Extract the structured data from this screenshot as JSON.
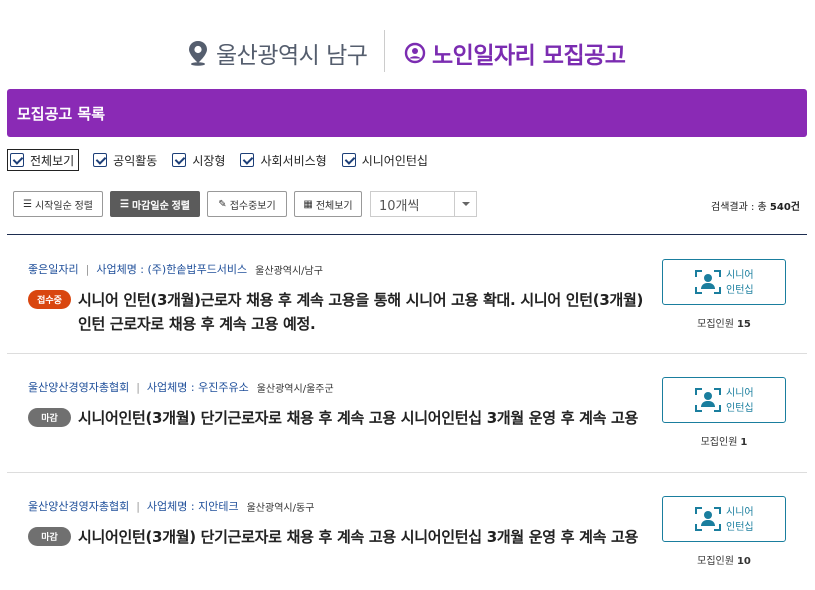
{
  "header": {
    "location": "울산광역시 남구",
    "title": "노인일자리 모집공고",
    "location_icon": "map-pin-icon",
    "title_icon": "person-circle-icon",
    "title_color": "#7b2cb1"
  },
  "section": {
    "title": "모집공고 목록",
    "color": "#8a2ab5"
  },
  "filters": [
    {
      "label": "전체보기",
      "checked": true
    },
    {
      "label": "공익활동",
      "checked": true
    },
    {
      "label": "시장형",
      "checked": true
    },
    {
      "label": "사회서비스형",
      "checked": true
    },
    {
      "label": "시니어인턴십",
      "checked": true
    }
  ],
  "toolbar": {
    "sort_start": "시작일순 정렬",
    "sort_deadline": "마감일순 정렬",
    "receiving": "접수중보기",
    "view_all": "전체보기",
    "per_page": "10개씩",
    "result_label": "검색결과 : 총",
    "result_count": "540건"
  },
  "items": [
    {
      "org": "좋은일자리",
      "biz": "사업체명 : (주)한솥밥푸드서비스",
      "region": "울산광역시/남구",
      "status": "접수중",
      "status_color": "#d9460f",
      "desc": "시니어 인턴(3개월)근로자 채용 후 계속 고용을 통해 시니어 고용 확대. 시니어 인턴(3개월)인턴 근로자로 채용 후 계속 고용 예정.",
      "type_line1": "시니어",
      "type_line2": "인턴십",
      "recruit_label": "모집인원",
      "recruit_count": "15"
    },
    {
      "org": "울산양산경영자총협회",
      "biz": "사업체명 : 우진주유소",
      "region": "울산광역시/울주군",
      "status": "마감",
      "status_color": "#707070",
      "desc": "시니어인턴(3개월) 단기근로자로 채용 후 계속 고용 시니어인턴십 3개월 운영 후 계속 고용",
      "type_line1": "시니어",
      "type_line2": "인턴십",
      "recruit_label": "모집인원",
      "recruit_count": "1"
    },
    {
      "org": "울산양산경영자총협회",
      "biz": "사업체명 : 지안테크",
      "region": "울산광역시/동구",
      "status": "마감",
      "status_color": "#707070",
      "desc": "시니어인턴(3개월) 단기근로자로 채용 후 계속 고용 시니어인턴십 3개월 운영 후 계속 고용",
      "type_line1": "시니어",
      "type_line2": "인턴십",
      "recruit_label": "모집인원",
      "recruit_count": "10"
    }
  ]
}
